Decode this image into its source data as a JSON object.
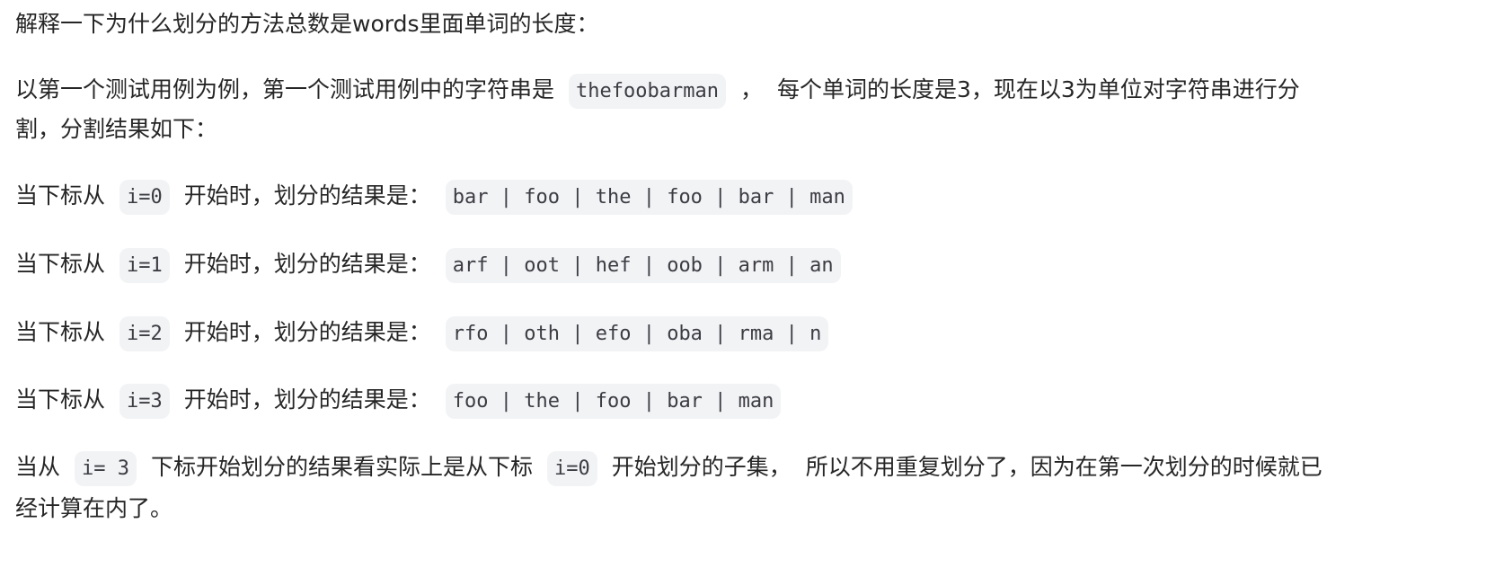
{
  "intro": "解释一下为什么划分的方法总数是words里面单词的长度：",
  "example": {
    "line1_a": "以第一个测试用例为例，第一个测试用例中的字符串是",
    "string_code": "thefoobarman",
    "line1_b": "，",
    "line1_c": "每个单词的长度是3，现在以3为单位对字符串进行分",
    "line2": "割，分割结果如下："
  },
  "splits": [
    {
      "prefix": "当下标从",
      "index_code": "i=0",
      "middle": "开始时，划分的结果是：",
      "result_code": "bar | foo | the | foo | bar | man"
    },
    {
      "prefix": "当下标从",
      "index_code": "i=1",
      "middle": "开始时，划分的结果是：",
      "result_code": "arf | oot | hef | oob | arm | an"
    },
    {
      "prefix": "当下标从",
      "index_code": "i=2",
      "middle": "开始时，划分的结果是：",
      "result_code": "rfo | oth | efo | oba | rma | n"
    },
    {
      "prefix": "当下标从",
      "index_code": "i=3",
      "middle": "开始时，划分的结果是：",
      "result_code": "foo | the | foo | bar | man"
    }
  ],
  "conclusion": {
    "a": "当从",
    "code1": "i= 3",
    "b": "下标开始划分的结果看实际上是从下标",
    "code2": "i=0",
    "c": "开始划分的子集，",
    "d": "所以不用重复划分了，因为在第一次划分的时候就已",
    "line2": "经计算在内了。"
  }
}
